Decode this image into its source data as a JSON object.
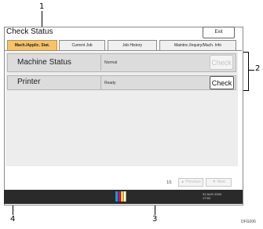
{
  "window": {
    "title": "Check Status",
    "exit_label": "Exit"
  },
  "tabs": [
    {
      "label": "Mach./Applic. Stat.",
      "active": true
    },
    {
      "label": "Current Job",
      "active": false
    },
    {
      "label": "Job History",
      "active": false
    },
    {
      "label": "Maintnc./Inquiry/Mach. Info",
      "active": false
    }
  ],
  "rows": [
    {
      "label": "Machine Status",
      "status": "Normal",
      "button_label": "Check",
      "button_enabled": false
    },
    {
      "label": "Printer",
      "status": "Ready",
      "button_label": "Check",
      "button_enabled": true
    }
  ],
  "pager": {
    "page": "1/1",
    "prev_label": "▲ Previous",
    "next_label": "▼ Next"
  },
  "statusbar": {
    "date_line1": "31 AUG  2004",
    "date_line2": "17:52"
  },
  "callouts": [
    "1",
    "2",
    "3",
    "4"
  ],
  "figure_code": "DFG006",
  "colors": {
    "active_tab": "#f6c36a",
    "statusbar": "#2a2a2a",
    "ink_bars": [
      "#00a0e0",
      "#e0007a",
      "#f0d000",
      "#111111"
    ]
  }
}
